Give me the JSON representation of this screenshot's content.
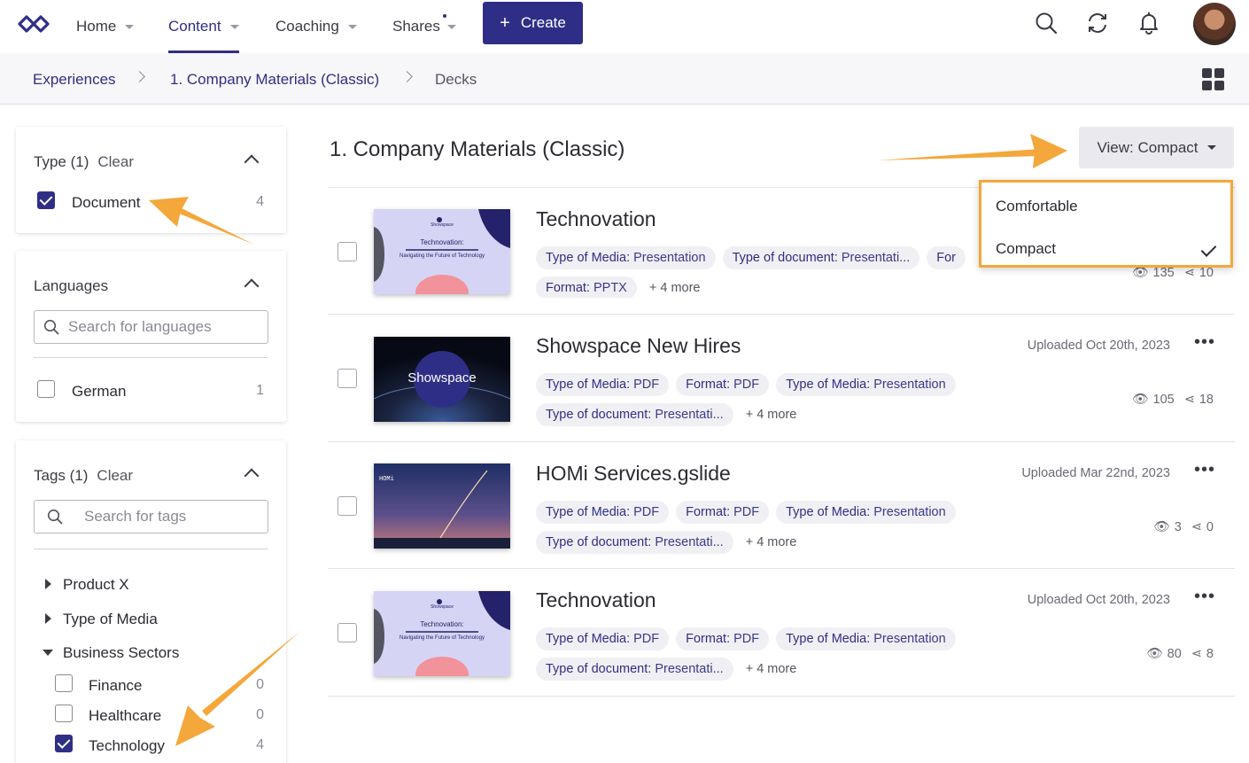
{
  "nav": {
    "items": [
      {
        "label": "Home"
      },
      {
        "label": "Content"
      },
      {
        "label": "Coaching"
      },
      {
        "label": "Shares"
      }
    ],
    "create_label": "Create",
    "create_icon": "plus-icon"
  },
  "breadcrumb": {
    "items": [
      "Experiences",
      "1. Company Materials (Classic)",
      "Decks"
    ]
  },
  "filters": {
    "type": {
      "title": "Type (1)",
      "clear": "Clear",
      "options": [
        {
          "label": "Document",
          "count": "4",
          "checked": true
        }
      ]
    },
    "languages": {
      "title": "Languages",
      "search_placeholder": "Search for languages",
      "options": [
        {
          "label": "German",
          "count": "1",
          "checked": false
        }
      ]
    },
    "tags": {
      "title": "Tags (1)",
      "clear": "Clear",
      "search_placeholder": "Search for tags",
      "groups": [
        {
          "label": "Product X",
          "expanded": false
        },
        {
          "label": "Type of Media",
          "expanded": false
        },
        {
          "label": "Business Sectors",
          "expanded": true
        }
      ],
      "options": [
        {
          "label": "Finance",
          "count": "0",
          "checked": false
        },
        {
          "label": "Healthcare",
          "count": "0",
          "checked": false
        },
        {
          "label": "Technology",
          "count": "4",
          "checked": true
        }
      ]
    }
  },
  "main": {
    "title": "1. Company Materials (Classic)",
    "view_button": "View: Compact",
    "view_menu": {
      "options": [
        "Comfortable",
        "Compact"
      ],
      "selected": "Compact"
    },
    "rows": [
      {
        "title": "Technovation",
        "thumb_brand": "Showspace",
        "thumb_heading": "Technovation:",
        "thumb_sub": "Navigating the Future of Technology",
        "tags": [
          {
            "k": "Type of Media",
            "v": "Presentation"
          },
          {
            "k": "Type of document",
            "v": "Presentati..."
          },
          {
            "k": "For",
            "v": ""
          },
          {
            "k": "Format",
            "v": "PPTX"
          }
        ],
        "more": "+ 4 more",
        "uploaded": "",
        "views": "135",
        "shares": "10"
      },
      {
        "title": "Showspace New Hires",
        "thumb_brand": "Showspace",
        "tags": [
          {
            "k": "Type of Media",
            "v": "PDF"
          },
          {
            "k": "Format",
            "v": "PDF"
          },
          {
            "k": "Type of Media",
            "v": "Presentation"
          },
          {
            "k": "Type of document",
            "v": "Presentati..."
          }
        ],
        "more": "+ 4 more",
        "uploaded": "Uploaded Oct 20th, 2023",
        "views": "105",
        "shares": "18"
      },
      {
        "title": "HOMi Services.gslide",
        "thumb_brand": "HOMi",
        "tags": [
          {
            "k": "Type of Media",
            "v": "PDF"
          },
          {
            "k": "Format",
            "v": "PDF"
          },
          {
            "k": "Type of Media",
            "v": "Presentation"
          },
          {
            "k": "Type of document",
            "v": "Presentati..."
          }
        ],
        "more": "+ 4 more",
        "uploaded": "Uploaded Mar 22nd, 2023",
        "views": "3",
        "shares": "0"
      },
      {
        "title": "Technovation",
        "thumb_brand": "Showspace",
        "thumb_heading": "Technovation:",
        "thumb_sub": "Navigating the Future of Technology",
        "tags": [
          {
            "k": "Type of Media",
            "v": "PDF"
          },
          {
            "k": "Format",
            "v": "PDF"
          },
          {
            "k": "Type of Media",
            "v": "Presentation"
          },
          {
            "k": "Type of document",
            "v": "Presentati..."
          }
        ],
        "more": "+ 4 more",
        "uploaded": "Uploaded Oct 20th, 2023",
        "views": "80",
        "shares": "8"
      }
    ]
  },
  "colors": {
    "accent": "#2f2e86",
    "annotation": "#f4a73a"
  }
}
